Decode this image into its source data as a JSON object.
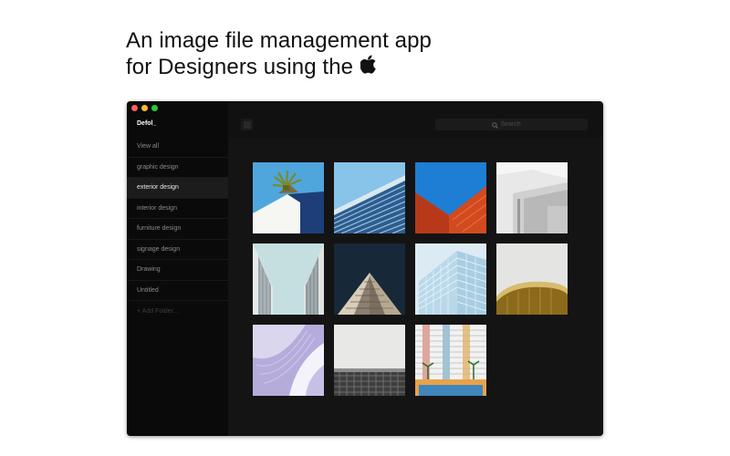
{
  "headline": {
    "line1": "An image file management app",
    "line2": "for Designers using the"
  },
  "window": {
    "app_name": "Defol_",
    "search_placeholder": "Search",
    "view_modes": [
      "grid",
      "list"
    ],
    "active_view": "grid"
  },
  "sidebar": {
    "items": [
      {
        "label": "View all",
        "active": false
      },
      {
        "label": "graphic design",
        "active": false
      },
      {
        "label": "exterior design",
        "active": true
      },
      {
        "label": "interior design",
        "active": false
      },
      {
        "label": "furniture design",
        "active": false
      },
      {
        "label": "signage design",
        "active": false
      },
      {
        "label": "Drawing",
        "active": false
      },
      {
        "label": "Untitled",
        "active": false
      }
    ],
    "add_folder_label": "+ Add Folder..."
  },
  "thumbnails": [
    {
      "name": "blue-building-with-palm",
      "subject": "building corner with palm tree against blue sky"
    },
    {
      "name": "blue-glass-facade",
      "subject": "diagonal blue glass facade against sky"
    },
    {
      "name": "red-brick-roofline",
      "subject": "red wall angles against blue sky"
    },
    {
      "name": "white-modern-building",
      "subject": "white modern building corner"
    },
    {
      "name": "tall-corridor-walls",
      "subject": "two tall walls framing pale sky"
    },
    {
      "name": "dark-triangular-facade",
      "subject": "dark triangular tower facade"
    },
    {
      "name": "glass-grid-tower",
      "subject": "pale blue glass grid tower"
    },
    {
      "name": "curved-gold-balcony",
      "subject": "curved balcony with gold band"
    },
    {
      "name": "lilac-curves",
      "subject": "lilac curved architecture"
    },
    {
      "name": "grey-grid-building",
      "subject": "grey grid building under cloudy sky"
    },
    {
      "name": "colorful-apartment-block",
      "subject": "colorful apartment block with palms"
    }
  ],
  "colors": {
    "window_bg": "#111111",
    "sidebar_bg": "#0a0a0a",
    "active_item_bg": "#1c1c1c",
    "content_bg": "#141414",
    "close": "#ff5f57",
    "minimize": "#febc2e",
    "maximize": "#28c840"
  }
}
